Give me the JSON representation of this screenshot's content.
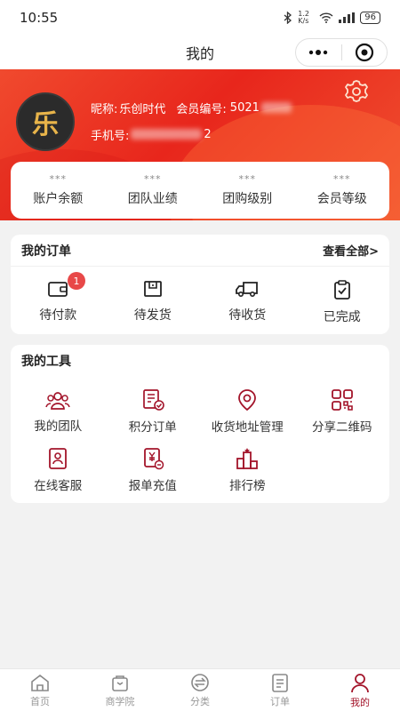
{
  "status_bar": {
    "time": "10:55",
    "network_speed": "1.2 K/s",
    "battery": "96"
  },
  "nav": {
    "title": "我的"
  },
  "profile": {
    "nickname_label": "昵称:",
    "nickname": "乐创时代",
    "member_no_label": "会员编号:",
    "member_no_visible": "5021",
    "phone_label": "手机号:",
    "phone_visible_suffix": "2",
    "avatar_text": "乐"
  },
  "stats": [
    {
      "value": "***",
      "label": "账户余额"
    },
    {
      "value": "***",
      "label": "团队业绩"
    },
    {
      "value": "***",
      "label": "团购级别"
    },
    {
      "value": "***",
      "label": "会员等级"
    }
  ],
  "orders": {
    "title": "我的订单",
    "view_all": "查看全部>",
    "items": [
      {
        "label": "待付款",
        "icon": "wallet-icon",
        "badge": "1"
      },
      {
        "label": "待发货",
        "icon": "package-icon"
      },
      {
        "label": "待收货",
        "icon": "truck-icon"
      },
      {
        "label": "已完成",
        "icon": "clipboard-check-icon"
      }
    ]
  },
  "tools": {
    "title": "我的工具",
    "items": [
      {
        "label": "我的团队",
        "icon": "team-icon"
      },
      {
        "label": "积分订单",
        "icon": "points-order-icon"
      },
      {
        "label": "收货地址管理",
        "icon": "location-pin-icon"
      },
      {
        "label": "分享二维码",
        "icon": "qr-code-icon"
      },
      {
        "label": "在线客服",
        "icon": "customer-service-icon"
      },
      {
        "label": "报单充值",
        "icon": "recharge-icon"
      },
      {
        "label": "排行榜",
        "icon": "ranking-icon"
      }
    ]
  },
  "tabbar": [
    {
      "label": "首页",
      "icon": "home-icon"
    },
    {
      "label": "商学院",
      "icon": "school-bag-icon"
    },
    {
      "label": "分类",
      "icon": "category-icon"
    },
    {
      "label": "订单",
      "icon": "order-list-icon"
    },
    {
      "label": "我的",
      "icon": "profile-icon",
      "active": true
    }
  ],
  "colors": {
    "brand_red": "#e8261c",
    "accent_dark_red": "#a3142a",
    "badge_red": "#e84848"
  }
}
